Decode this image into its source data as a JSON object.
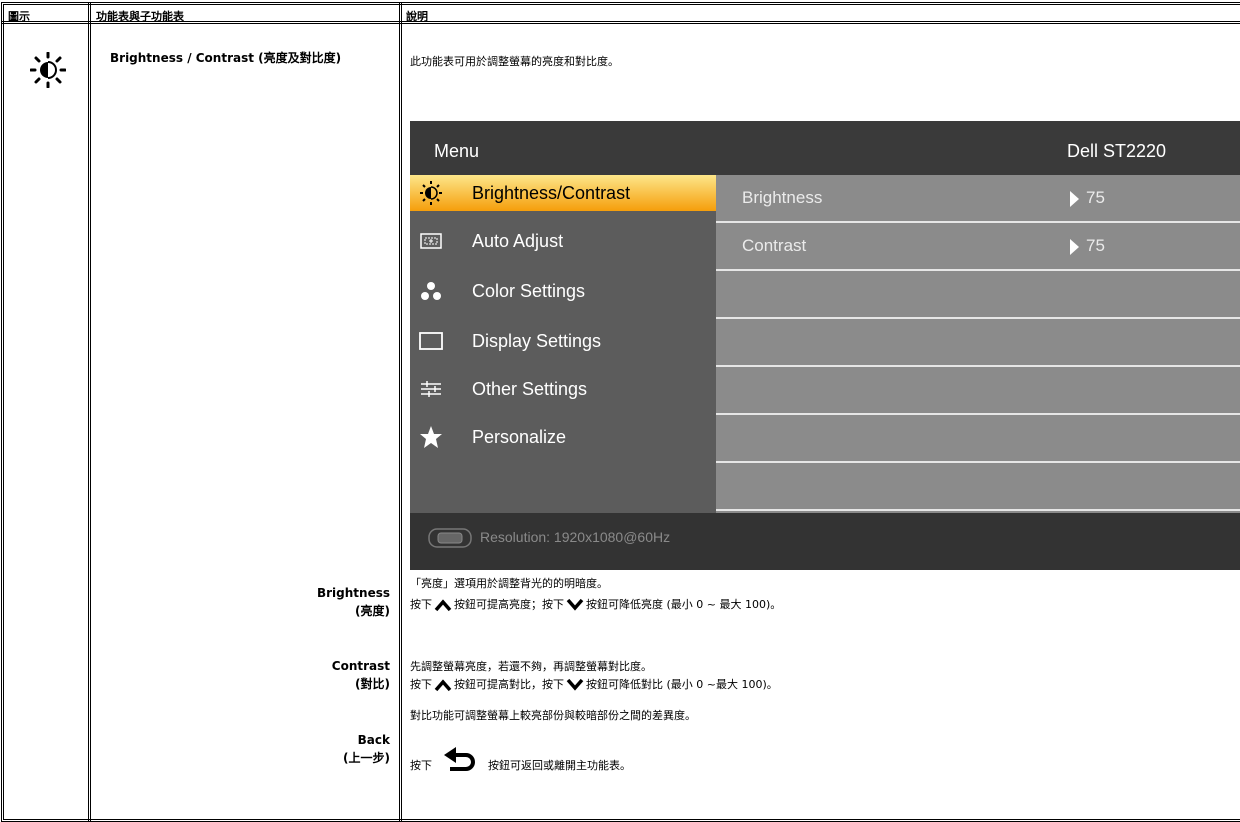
{
  "headers": {
    "icon": "圖示",
    "menu": "功能表與子功能表",
    "desc": "說明"
  },
  "row": {
    "icon": "sun-brightness-icon",
    "title": "Brightness / Contrast (亮度及對比度)",
    "intro": "此功能表可用於調整螢幕的亮度和對比度。"
  },
  "osd": {
    "title": "Menu",
    "model": "Dell ST2220",
    "menu_items": [
      {
        "label": "Brightness/Contrast",
        "icon": "brightness-icon",
        "selected": true
      },
      {
        "label": "Auto Adjust",
        "icon": "auto-adjust-icon"
      },
      {
        "label": "Color Settings",
        "icon": "color-dots-icon"
      },
      {
        "label": "Display Settings",
        "icon": "display-rect-icon"
      },
      {
        "label": "Other Settings",
        "icon": "sliders-icon"
      },
      {
        "label": "Personalize",
        "icon": "star-icon"
      }
    ],
    "right_rows": [
      {
        "label": "Brightness",
        "value": "75"
      },
      {
        "label": "Contrast",
        "value": "75"
      }
    ],
    "resolution": "Resolution:  1920x1080@60Hz",
    "colors": {
      "top": "#3a3a3a",
      "left": "#5c5c5c",
      "right": "#8b8b8b",
      "selected": "#f59e0b"
    }
  },
  "brightness": {
    "name": "Brightness",
    "name_zh": "(亮度)",
    "line1": "「亮度」選項用於調整背光的的明暗度。",
    "line2_a": "按下",
    "line2_b": "按鈕可提高亮度；按下",
    "line2_c": "按鈕可降低亮度 (最小 0 ~ 最大 100)。"
  },
  "contrast": {
    "name": "Contrast",
    "name_zh": "(對比)",
    "line1": "先調整螢幕亮度，若還不夠，再調整螢幕對比度。",
    "line2_a": "按下",
    "line2_b": "按鈕可提高對比，按下",
    "line2_c": "按鈕可降低對比 (最小 0 ~最大 100)。",
    "line3": "對比功能可調整螢幕上較亮部份與較暗部份之間的差異度。"
  },
  "back": {
    "name": "Back",
    "name_zh": "(上一步)",
    "line_a": "按下",
    "line_b": "按鈕可返回或離開主功能表。"
  }
}
